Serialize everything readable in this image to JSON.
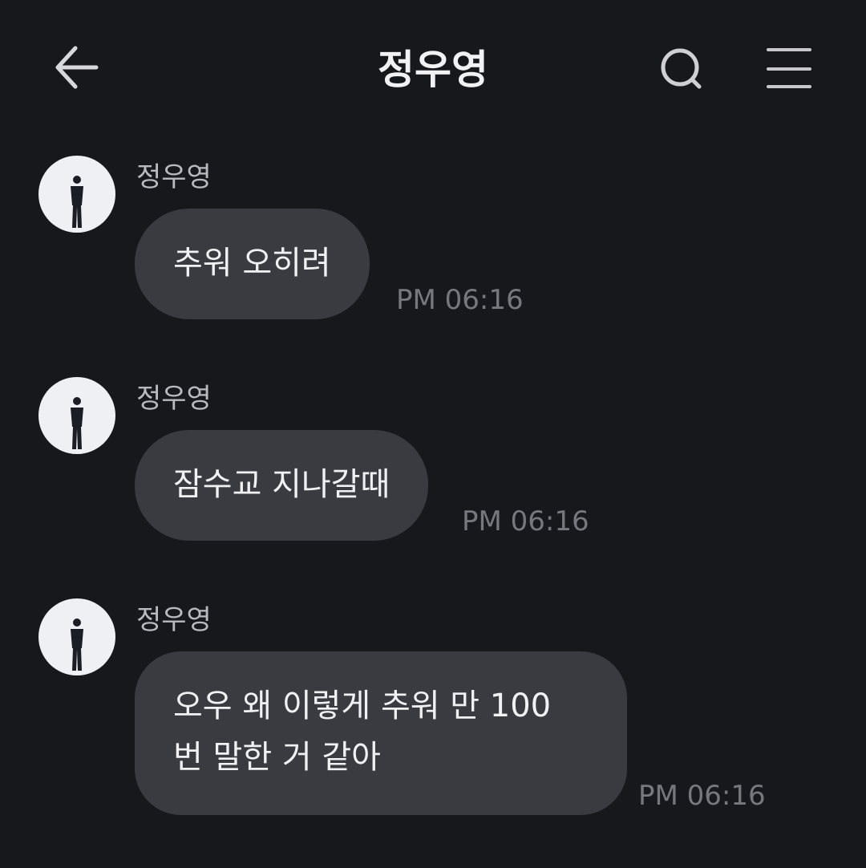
{
  "header": {
    "title": "정우영",
    "icons": {
      "back": "arrow-left-icon",
      "search": "search-icon",
      "menu": "hamburger-menu-icon"
    }
  },
  "colors": {
    "background": "#17181c",
    "bubble": "#3a3b41",
    "timestamp": "#77787e",
    "sender": "#b9babf"
  },
  "messages": [
    {
      "sender": "정우영",
      "text": "추워 오히려",
      "time": "PM 06:16"
    },
    {
      "sender": "정우영",
      "text": "잠수교 지나갈때",
      "time": "PM 06:16"
    },
    {
      "sender": "정우영",
      "lines": [
        "오우 왜 이렇게 추워 만 100",
        "번 말한 거 같아"
      ],
      "time": "PM 06:16"
    }
  ]
}
